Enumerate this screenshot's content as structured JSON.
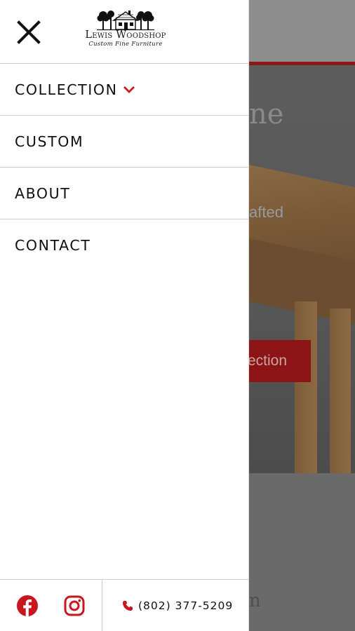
{
  "logo": {
    "title": "Lewis Woodshop",
    "tagline": "Custom Fine Furniture"
  },
  "menu": {
    "items": [
      {
        "label": "COLLECTION",
        "has_dropdown": true
      },
      {
        "label": "CUSTOM",
        "has_dropdown": false
      },
      {
        "label": "ABOUT",
        "has_dropdown": false
      },
      {
        "label": "CONTACT",
        "has_dropdown": false
      }
    ]
  },
  "footer": {
    "phone": "(802) 377-5209",
    "social": [
      "facebook-icon",
      "instagram-icon"
    ]
  },
  "background": {
    "heading_fragment": "ne",
    "subtext_fragment": "afted",
    "button_fragment": "ection",
    "lower_fragment": "n"
  },
  "colors": {
    "accent": "#c8161d",
    "text": "#111111",
    "divider": "#cfcfcf"
  }
}
